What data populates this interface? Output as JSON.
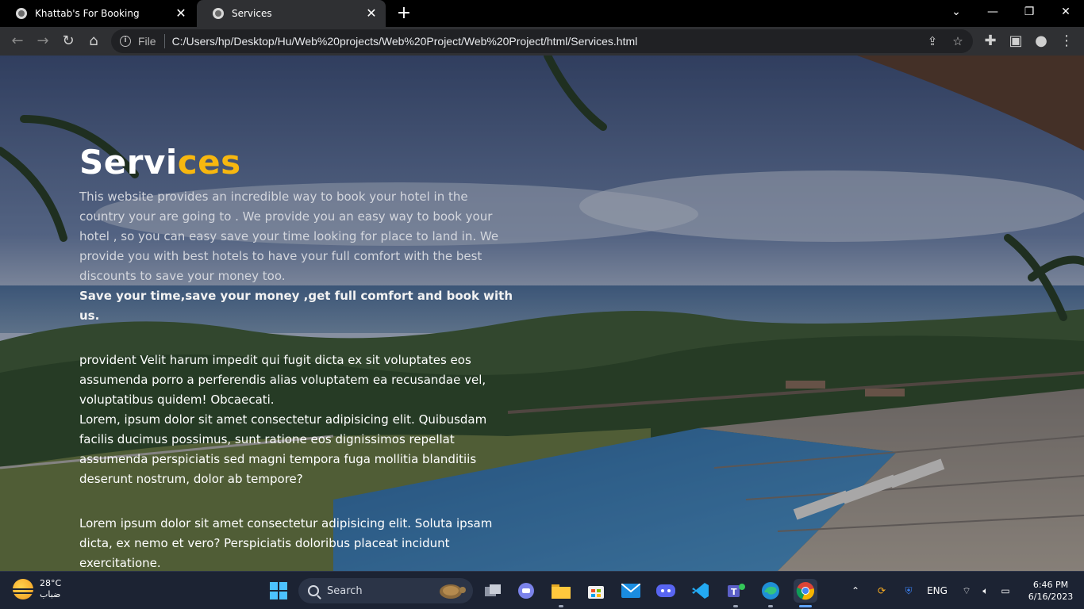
{
  "browser": {
    "tabs": [
      {
        "title": "Khattab's For Booking",
        "active": false
      },
      {
        "title": "Services",
        "active": true
      }
    ],
    "address": {
      "scheme_label": "File",
      "url": "C:/Users/hp/Desktop/Hu/Web%20projects/Web%20Project/Web%20Project/html/Services.html"
    }
  },
  "page": {
    "heading_plain": "Servi",
    "heading_accent": "ces",
    "intro": "This website provides an incredible way to book your hotel in the country your are going to . We provide you an easy way to book your hotel , so you can easy save your time looking for place to land in. We provide you with best hotels to have your full comfort with the best discounts to save your money too.",
    "slogan": "Save your time,save your money ,get full comfort and book with us.",
    "para2a": "provident Velit harum impedit qui fugit dicta ex sit voluptates eos assumenda porro a perferendis alias voluptatem ea recusandae vel, voluptatibus quidem! Obcaecati.",
    "para2b": "Lorem, ipsum dolor sit amet consectetur adipisicing elit. Quibusdam facilis ducimus possimus, sunt ratione eos dignissimos repellat assumenda perspiciatis sed magni tempora fuga mollitia blanditiis deserunt nostrum, dolor ab tempore?",
    "para3": "Lorem ipsum dolor sit amet consectetur adipisicing elit. Soluta ipsam dicta, ex nemo et vero? Perspiciatis doloribus placeat incidunt exercitatione.",
    "accent_color": "#f7b70f"
  },
  "taskbar": {
    "weather_temp": "28°C",
    "weather_desc": "ضباب",
    "search_label": "Search",
    "language": "ENG",
    "time": "6:46 PM",
    "date": "6/16/2023"
  }
}
